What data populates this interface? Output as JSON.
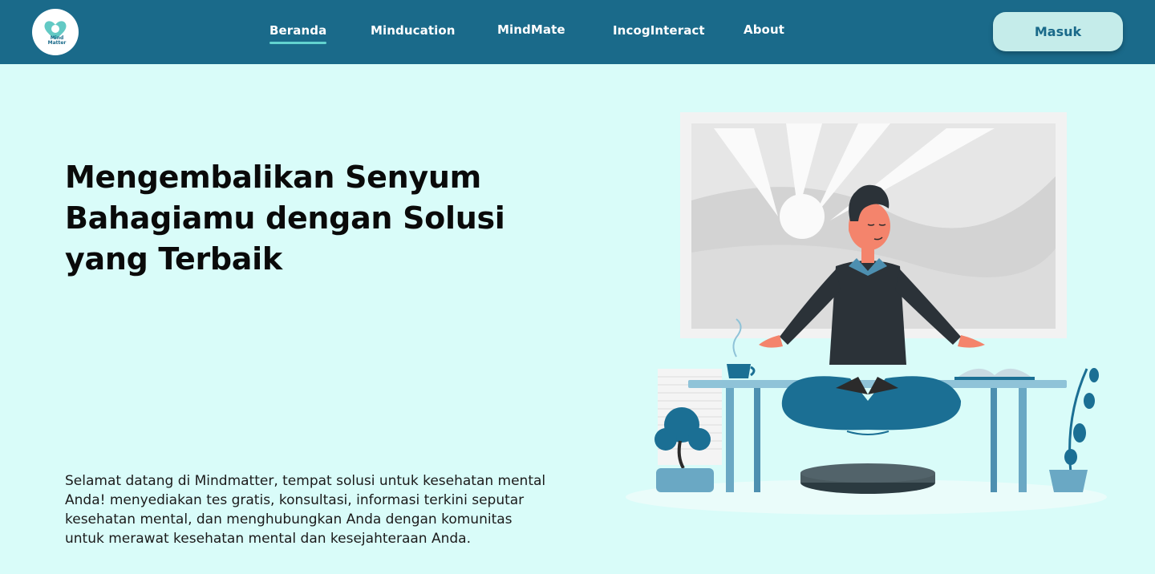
{
  "brand": {
    "logo_line1": "Mind",
    "logo_line2": "Matter"
  },
  "nav": {
    "items": [
      {
        "label": "Beranda",
        "active": true
      },
      {
        "label": "Minducation",
        "active": false
      },
      {
        "label": "MindMate",
        "active": false
      },
      {
        "label": "IncogInteract",
        "active": false
      },
      {
        "label": "About",
        "active": false
      }
    ],
    "login_label": "Masuk"
  },
  "hero": {
    "title_line1": "Mengembalikan Senyum",
    "title_line2": "Bahagiamu dengan Solusi",
    "title_line3": "yang Terbaik",
    "description": "Selamat datang di Mindmatter, tempat solusi untuk kesehatan mental Anda!  menyediakan tes gratis, konsultasi, informasi terkini seputar kesehatan mental, dan menghubungkan Anda dengan komunitas untuk merawat kesehatan mental dan kesejahteraan Anda."
  },
  "colors": {
    "navbar": "#1a6a8a",
    "background": "#d9fcf9",
    "accent": "#62d3cf",
    "button": "#c5ecea"
  }
}
